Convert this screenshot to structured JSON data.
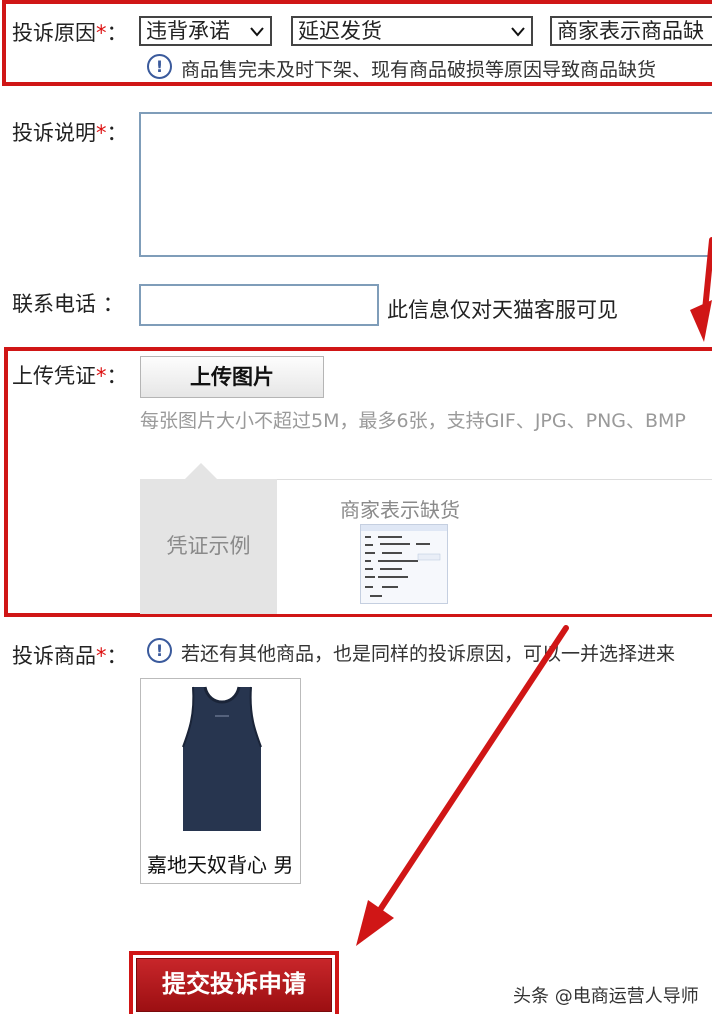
{
  "complaint_reason": {
    "label": "投诉原因",
    "required_mark": "*",
    "colon": "：",
    "select1_value": "违背承诺",
    "select2_value": "延迟发货",
    "select3_value": "商家表示商品缺",
    "hint": "商品售完未及时下架、现有商品破损等原因导致商品缺货"
  },
  "complaint_desc": {
    "label": "投诉说明",
    "required_mark": "*",
    "colon": "："
  },
  "phone": {
    "label": "联系电话",
    "colon": "：",
    "note": "此信息仅对天猫客服可见"
  },
  "evidence": {
    "label": "上传凭证",
    "required_mark": "*",
    "colon": "：",
    "upload_button": "上传图片",
    "hint": "每张图片大小不超过5M，最多6张，支持GIF、JPG、PNG、BMP",
    "example_tab": "凭证示例",
    "example_caption": "商家表示缺货"
  },
  "product": {
    "label": "投诉商品",
    "required_mark": "*",
    "colon": "：",
    "hint": "若还有其他商品，也是同样的投诉原因，可以一并选择进来",
    "name": "嘉地天奴背心 男"
  },
  "submit": {
    "label": "提交投诉申请"
  },
  "watermark": "头条 @电商运营人导师",
  "colors": {
    "accent_red": "#d01616",
    "submit_red": "#b01a1d",
    "info_blue": "#3a5a9c"
  }
}
